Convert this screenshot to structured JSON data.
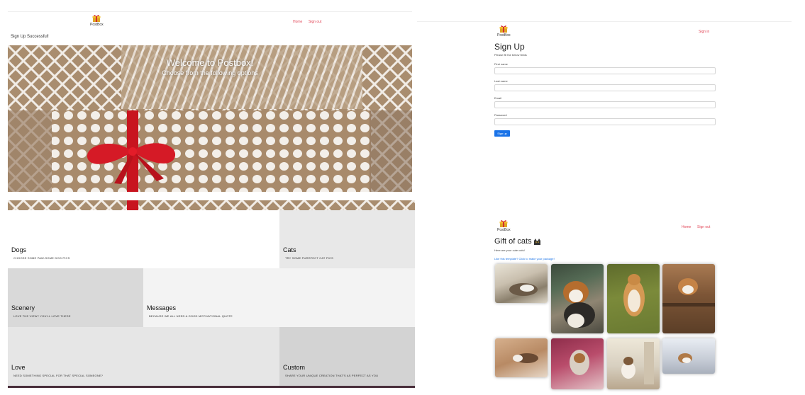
{
  "brand": "PostBox",
  "home_panel": {
    "nav": {
      "home": "Home",
      "signout": "Sign out"
    },
    "success_message": "Sign Up Successful!",
    "hero_title": "Welcome to Postbox!",
    "hero_subtitle": "Choose from the following options"
  },
  "categories": [
    {
      "title": "Dogs",
      "subtitle": "CHOOSE SOME PAW-SOME DOG PICS"
    },
    {
      "title": "Cats",
      "subtitle": "TRY SOME PURRFECT CAT PICS"
    },
    {
      "title": "Scenery",
      "subtitle": "LOVE THE VIEW? YOU'LL LOVE THESE"
    },
    {
      "title": "Messages",
      "subtitle": "BECAUSE WE ALL NEED A GOOD MOTIVATIONAL QUOTE"
    },
    {
      "title": "Love",
      "subtitle": "NEED SOMETHING SPECIAL FOR THAT SPECIAL SOMEONE?"
    },
    {
      "title": "Custom",
      "subtitle": "SHARE YOUR UNIQUE CREATION THAT'S AS PERFECT AS YOU"
    }
  ],
  "signup_panel": {
    "nav": {
      "signin": "Sign in"
    },
    "title": "Sign Up",
    "subtitle": "Please fill the below fields",
    "fields": {
      "first_name": "First name",
      "last_name": "Last name",
      "email": "Email",
      "password": "Password"
    },
    "submit": "Sign up"
  },
  "cats_panel": {
    "nav": {
      "home": "Home",
      "signout": "Sign out"
    },
    "title": "Gift of cats",
    "subtitle": "Here are your cute cats!",
    "template_link": "Like this template? Click to make your package!"
  },
  "colors": {
    "accent_link": "#e2495a",
    "button_blue": "#1a73e8",
    "ribbon_red": "#c8141f"
  },
  "icons": [
    "gift-icon",
    "cat-icon"
  ]
}
